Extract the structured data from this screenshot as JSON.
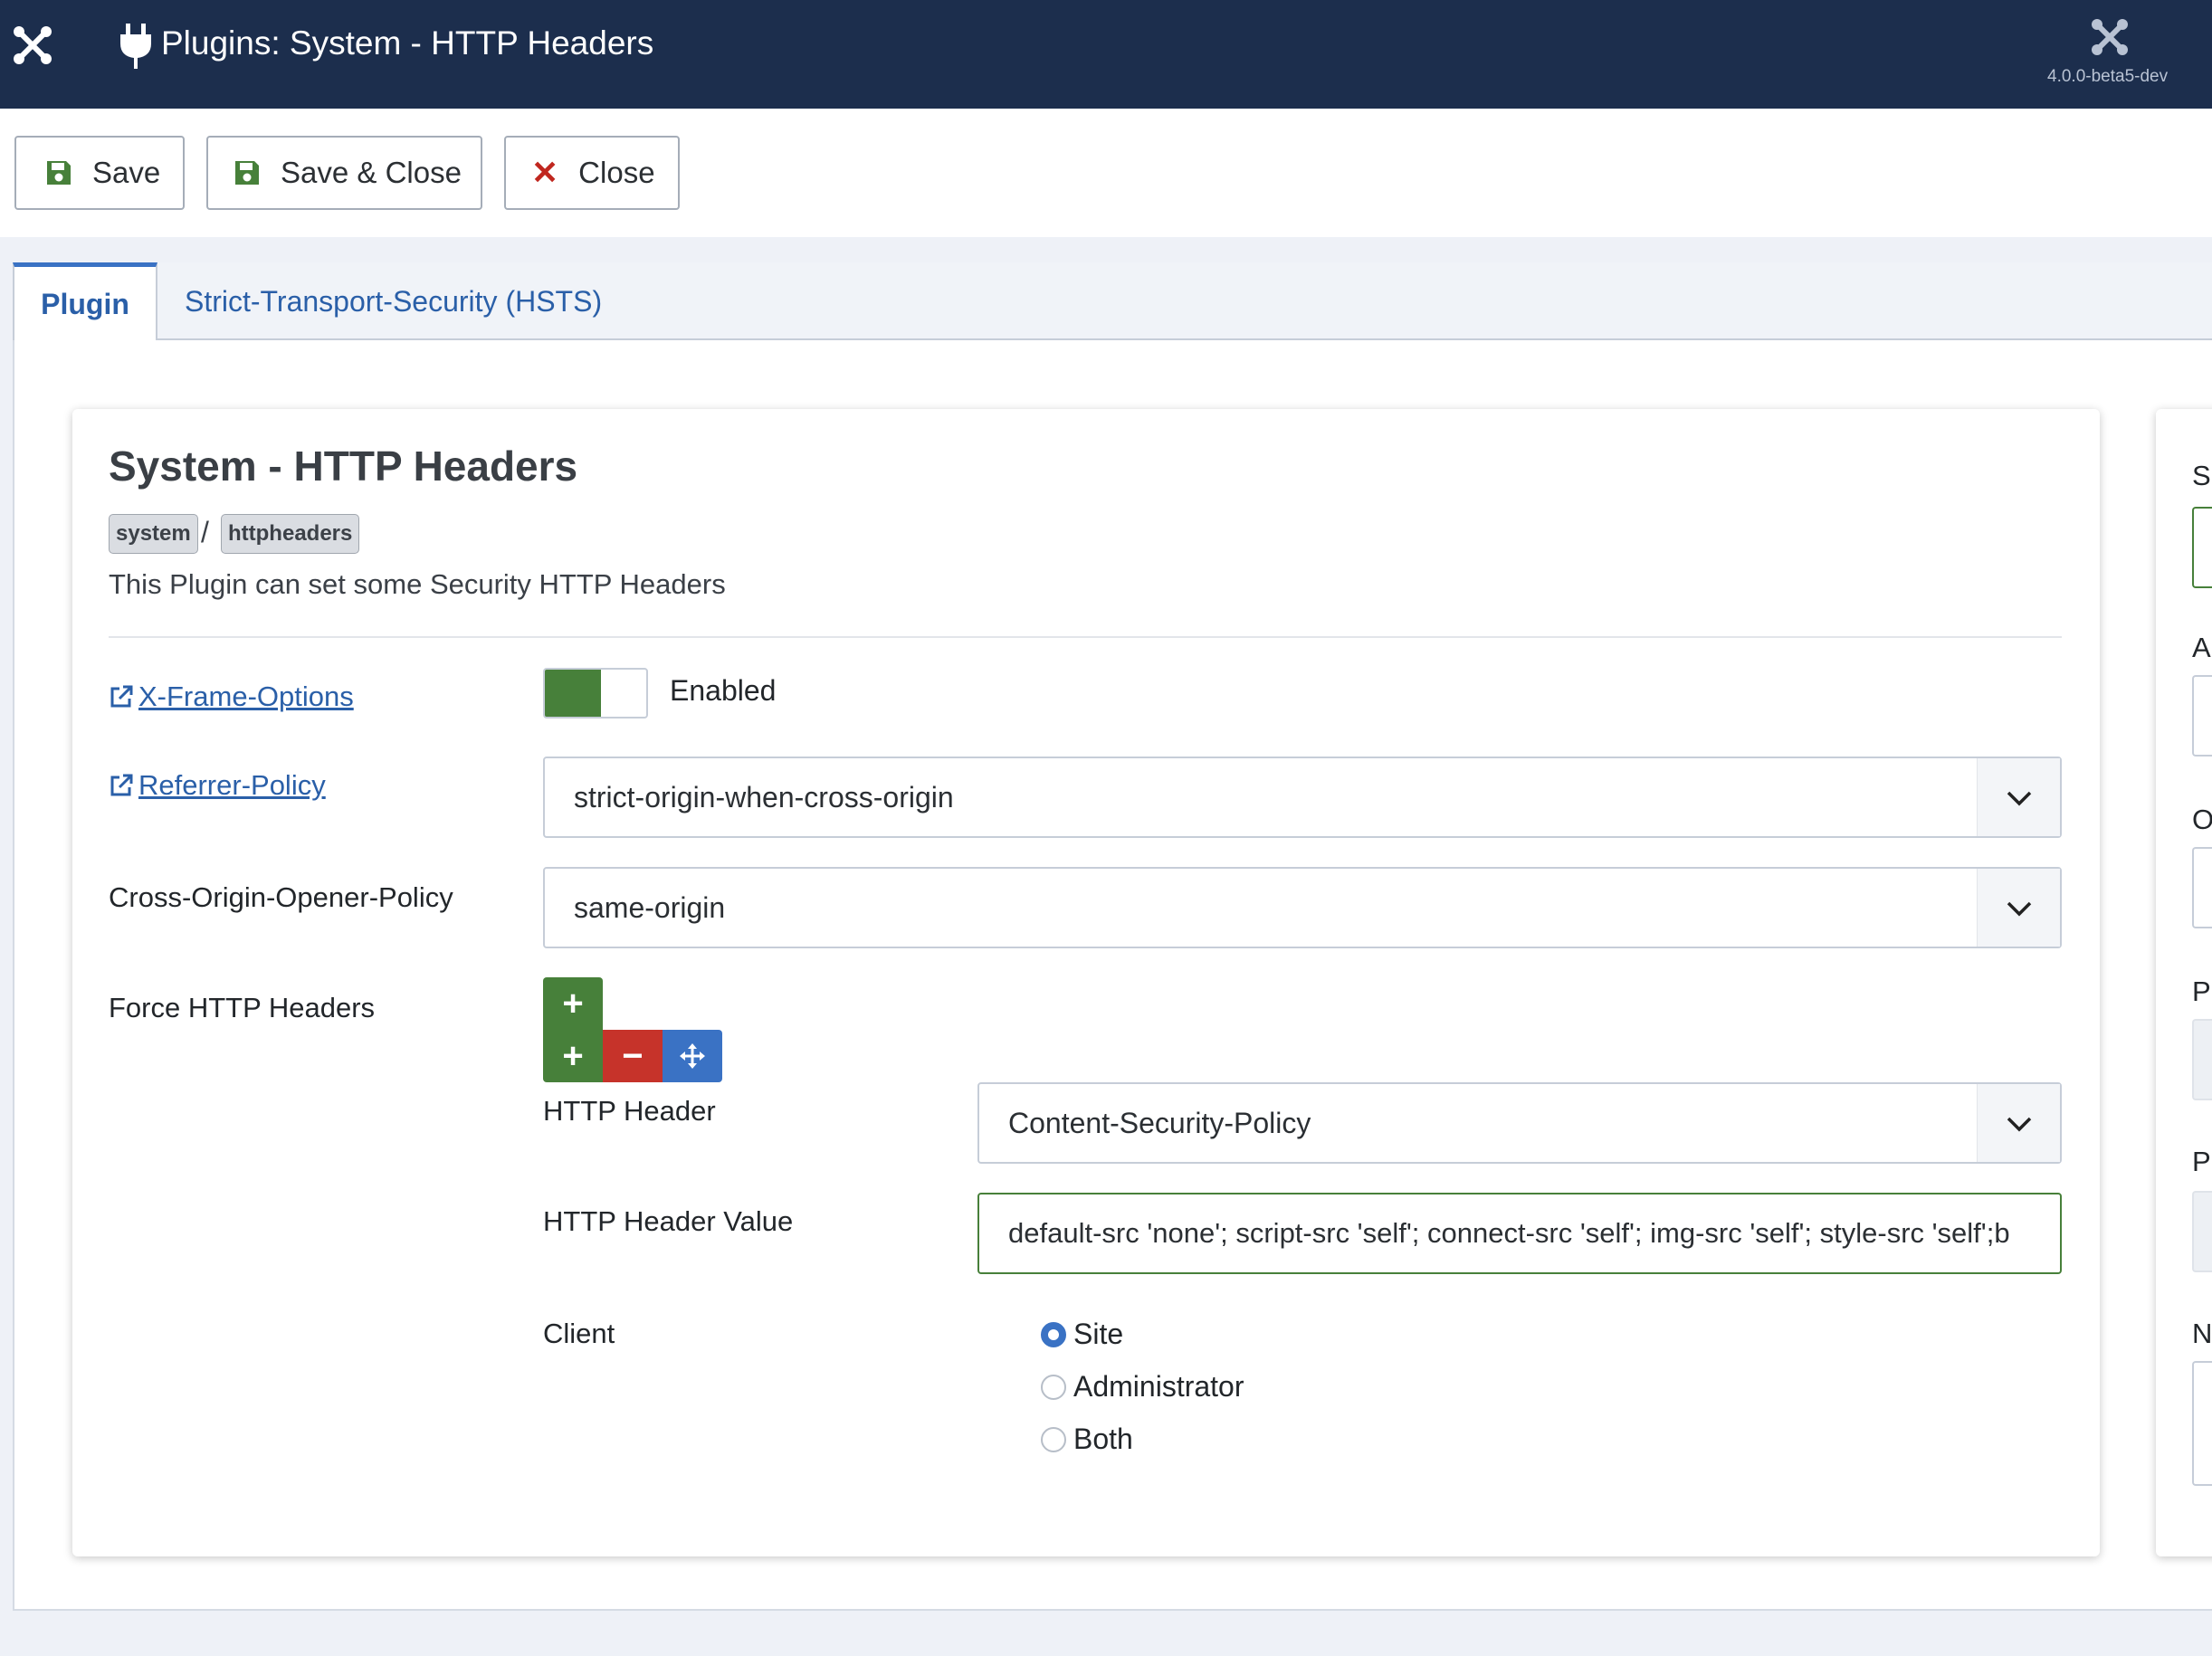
{
  "header": {
    "title": "Plugins: System - HTTP Headers",
    "version": "4.0.0-beta5-dev",
    "logo_icon": "joomla-logo-icon",
    "title_icon": "plug-icon"
  },
  "toolbar": {
    "save_label": "Save",
    "save_close_label": "Save & Close",
    "close_label": "Close"
  },
  "tabs": [
    {
      "label": "Plugin",
      "active": true
    },
    {
      "label": "Strict-Transport-Security (HSTS)",
      "active": false
    }
  ],
  "plugin": {
    "title": "System - HTTP Headers",
    "badges": [
      "system",
      "httpheaders"
    ],
    "separator": "/",
    "description": "This Plugin can set some Security HTTP Headers"
  },
  "fields": {
    "xframe": {
      "label": "X-Frame-Options",
      "state": "Enabled"
    },
    "referrer": {
      "label": "Referrer-Policy",
      "value": "strict-origin-when-cross-origin"
    },
    "coop": {
      "label": "Cross-Origin-Opener-Policy",
      "value": "same-origin"
    },
    "force": {
      "label": "Force HTTP Headers"
    }
  },
  "subform": {
    "header_label": "HTTP Header",
    "header_value": "Content-Security-Policy",
    "value_label": "HTTP Header Value",
    "value_value": "default-src 'none'; script-src 'self'; connect-src 'self'; img-src 'self'; style-src 'self';b",
    "client_label": "Client",
    "client_options": [
      "Site",
      "Administrator",
      "Both"
    ],
    "client_selected": "Site"
  },
  "sidebar_cut": {
    "letters": [
      "S",
      "A",
      "O",
      "P",
      "P",
      "N"
    ]
  },
  "colors": {
    "header_bg": "#1c2e4d",
    "accent_blue": "#3a72c4",
    "success_green": "#47803a",
    "danger_red": "#c6332a"
  }
}
